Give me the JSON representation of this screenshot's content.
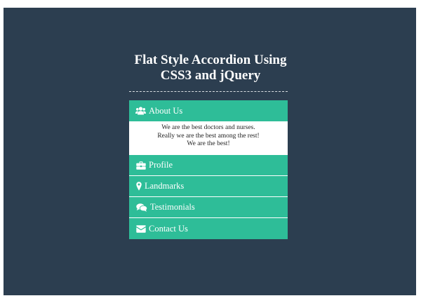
{
  "page": {
    "title_line1": "Flat Style Accordion Using",
    "title_line2": "CSS3 and jQuery"
  },
  "colors": {
    "background": "#2c3e50",
    "accent": "#2ebd98",
    "panel": "#ffffff"
  },
  "accordion": {
    "items": [
      {
        "label": "About Us",
        "icon": "users-icon",
        "expanded": true,
        "content": [
          "We are the best doctors and nurses.",
          "Really we are the best among the rest!",
          "We are the best!"
        ]
      },
      {
        "label": "Profile",
        "icon": "briefcase-icon",
        "expanded": false
      },
      {
        "label": "Landmarks",
        "icon": "map-marker-icon",
        "expanded": false
      },
      {
        "label": "Testimonials",
        "icon": "comments-icon",
        "expanded": false
      },
      {
        "label": "Contact Us",
        "icon": "envelope-icon",
        "expanded": false
      }
    ]
  }
}
